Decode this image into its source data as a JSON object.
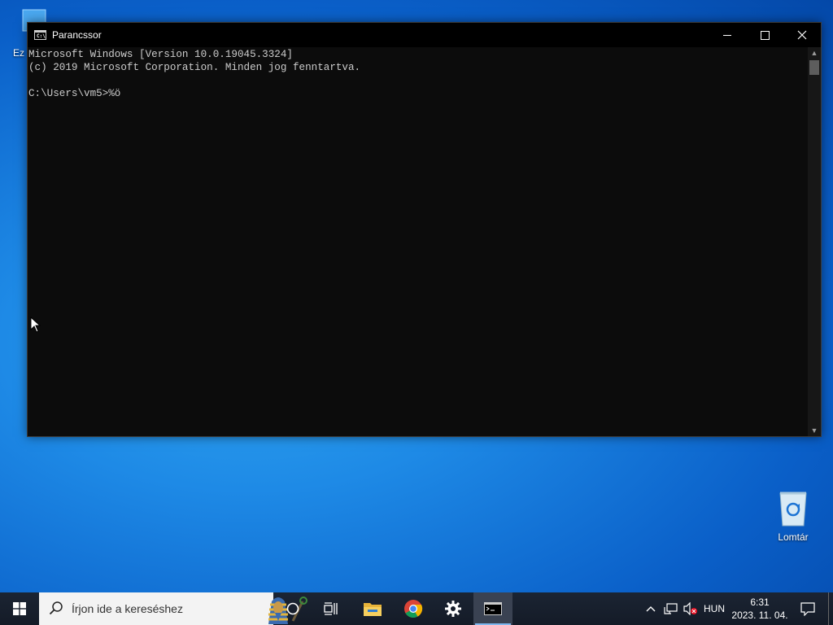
{
  "desktop": {
    "icons": [
      {
        "id": "thispc",
        "label": "Ez"
      },
      {
        "id": "recycle",
        "label": "Lomtár"
      }
    ]
  },
  "window": {
    "title": "Parancssor",
    "icon": "cmd-icon",
    "controls": {
      "minimize": "minimize-icon",
      "maximize": "maximize-icon",
      "close": "close-icon"
    }
  },
  "console": {
    "lines": [
      "Microsoft Windows [Version 10.0.19045.3324]",
      "(c) 2019 Microsoft Corporation. Minden jog fenntartva.",
      "",
      "C:\\Users\\vm5>%ö"
    ]
  },
  "taskbar": {
    "search_placeholder": "Írjon ide a kereséshez",
    "apps": [
      "windows-start-icon",
      "cortana-icon",
      "task-view-icon",
      "file-explorer-icon",
      "chrome-icon",
      "settings-icon",
      "command-prompt-icon"
    ],
    "tray": {
      "language": "HUN",
      "time": "6:31",
      "date": "2023. 11. 04."
    }
  },
  "colors": {
    "console_bg": "#0c0c0c",
    "console_text": "#cccccc",
    "taskbar_bg": "#141b27",
    "desktop_blue": "#1e8ae6"
  }
}
